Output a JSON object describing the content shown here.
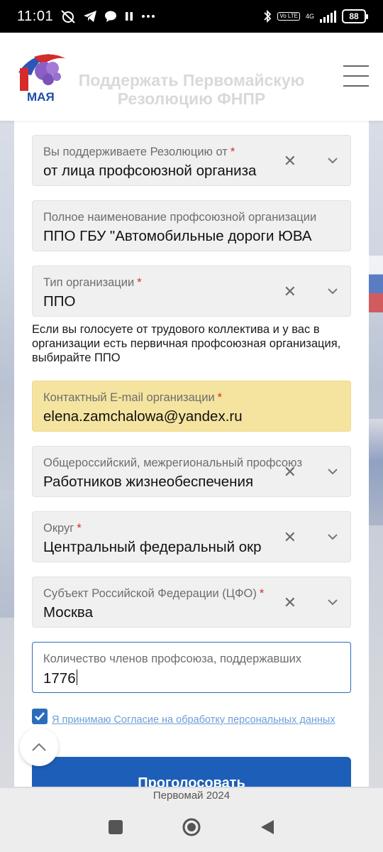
{
  "status_bar": {
    "time": "11:01",
    "network_type": "4G",
    "volte": "Vo LTE",
    "battery": "88",
    "icons": [
      "alarm-off-icon",
      "telegram-icon",
      "chat-icon",
      "pause-icon",
      "more-dots-icon",
      "bluetooth-icon",
      "volte-icon",
      "signal-icon",
      "battery-icon"
    ]
  },
  "header": {
    "logo_text": "МАЯ",
    "title": "Поддержать Первомайскую Резолюцию ФНПР",
    "menu_icon": "hamburger-menu-icon"
  },
  "form": {
    "fields": [
      {
        "label": "Вы поддерживаете Резолюцию от",
        "required": true,
        "value": "от лица профсоюзной организа",
        "clearable": true,
        "dropdown": true
      },
      {
        "label": "Полное наименование профсоюзной организации",
        "required": false,
        "value": "ППО ГБУ \"Автомобильные дороги ЮВА",
        "clearable": false,
        "dropdown": false
      },
      {
        "label": "Тип организации",
        "required": true,
        "value": "ППО",
        "clearable": true,
        "dropdown": true
      },
      {
        "label": "Контактный E-mail организации",
        "required": true,
        "value": "elena.zamchalowa@yandex.ru",
        "clearable": false,
        "dropdown": false
      },
      {
        "label": "Общероссийский, межрегиональный профсоюз",
        "required": false,
        "value": "Работников жизнеобеспечения",
        "clearable": true,
        "dropdown": true
      },
      {
        "label": "Округ",
        "required": true,
        "value": "Центральный федеральный окр",
        "clearable": true,
        "dropdown": true
      },
      {
        "label": "Субъект Российской Федерации (ЦФО)",
        "required": true,
        "value": "Москва",
        "clearable": true,
        "dropdown": true
      },
      {
        "label": "Количество членов профсоюза, поддержавших",
        "required": false,
        "value": "1776",
        "clearable": false,
        "dropdown": false
      }
    ],
    "hint": "Если вы голосуете от трудового коллектива и у вас в организации есть первичная профсоюзная организация, выбирайте ППО",
    "required_mark": "*",
    "clear_symbol": "✕",
    "consent": {
      "checked": true,
      "label": "Я принимаю Согласие на обработку персональных данных"
    },
    "submit_label": "Проголосовать"
  },
  "footer": {
    "text": "Первомай 2024"
  },
  "colors": {
    "accent": "#1d5fb8",
    "highlight": "#f5e4a0",
    "required": "#d32f2f",
    "link": "#6c9ed8"
  },
  "nav": {
    "icons": [
      "recent-apps-icon",
      "home-icon",
      "back-icon"
    ]
  }
}
